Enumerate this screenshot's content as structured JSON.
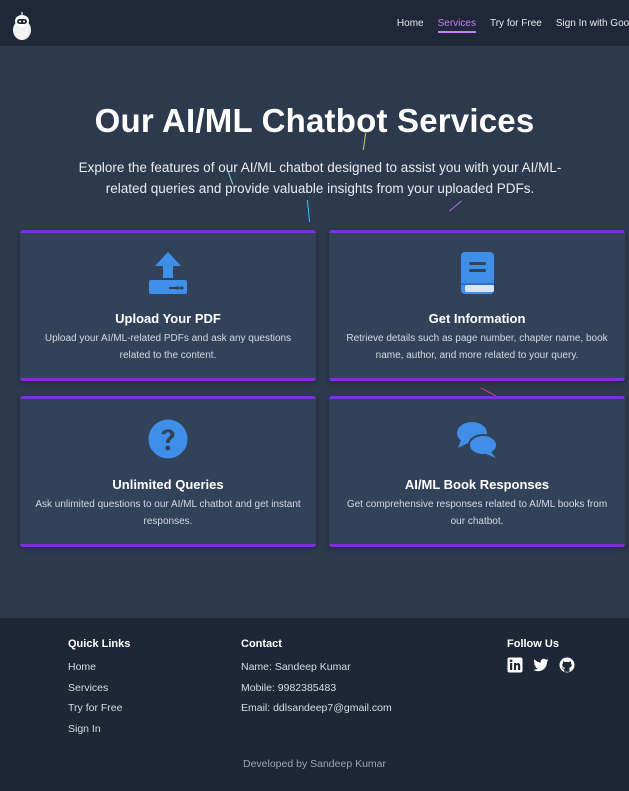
{
  "nav": {
    "links": [
      "Home",
      "Services",
      "Try for Free",
      "Sign In with Googl"
    ],
    "active": "Services"
  },
  "hero": {
    "title": "Our AI/ML Chatbot Services",
    "subtitle": "Explore the features of our AI/ML chatbot designed to assist you with your AI/ML-related queries and provide valuable insights from your uploaded PDFs."
  },
  "cards": [
    {
      "icon": "upload-icon",
      "title": "Upload Your PDF",
      "desc": "Upload your AI/ML-related PDFs and ask any questions related to the content."
    },
    {
      "icon": "book-icon",
      "title": "Get Information",
      "desc": "Retrieve details such as page number, chapter name, book name, author, and more related to your query."
    },
    {
      "icon": "question-circle-icon",
      "title": "Unlimited Queries",
      "desc": "Ask unlimited questions to our AI/ML chatbot and get instant responses."
    },
    {
      "icon": "comments-icon",
      "title": "AI/ML Book Responses",
      "desc": "Get comprehensive responses related to AI/ML books from our chatbot."
    }
  ],
  "footer": {
    "quick_links": {
      "heading": "Quick Links",
      "items": [
        "Home",
        "Services",
        "Try for Free",
        "Sign In"
      ]
    },
    "contact": {
      "heading": "Contact",
      "items": [
        "Name: Sandeep Kumar",
        "Mobile: 9982385483",
        "Email: ddlsandeep7@gmail.com"
      ]
    },
    "follow": {
      "heading": "Follow Us",
      "icons": [
        "linkedin-icon",
        "twitter-icon",
        "github-icon"
      ]
    },
    "credit": "Developed by Sandeep Kumar"
  },
  "colors": {
    "accent": "#7e2fd8",
    "active_link": "#d07bff",
    "icon_blue": "#3f8fe8",
    "background": "#2d3a4d"
  }
}
